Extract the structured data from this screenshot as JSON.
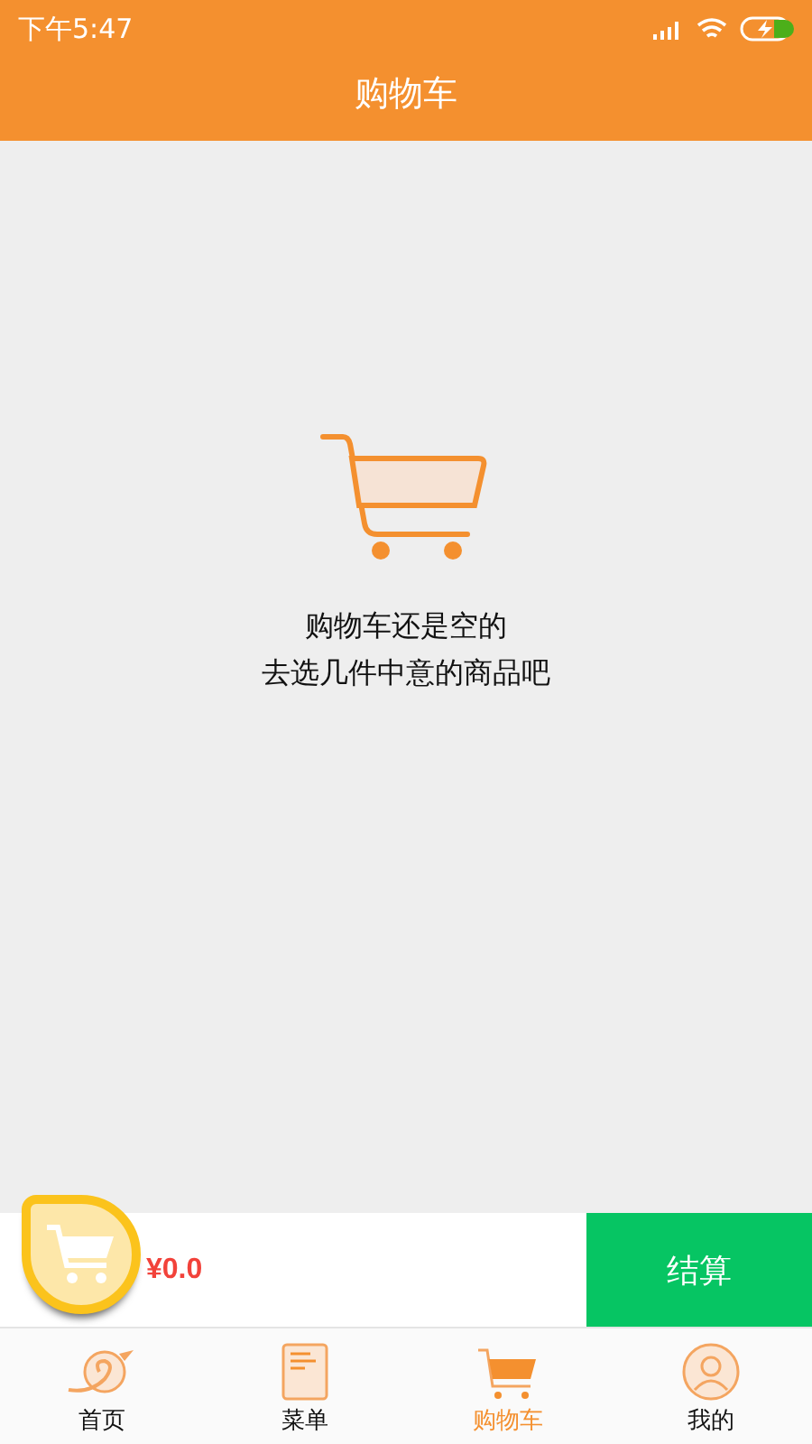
{
  "status_bar": {
    "time": "下午5:47"
  },
  "header": {
    "title": "购物车"
  },
  "empty_state": {
    "lines": [
      "购物车还是空的",
      "去选几件中意的商品吧"
    ]
  },
  "checkout_bar": {
    "total": "¥0.0",
    "button": "结算"
  },
  "tabs": [
    {
      "label": "首页",
      "kind": "home",
      "selected": false
    },
    {
      "label": "菜单",
      "kind": "menu",
      "selected": false
    },
    {
      "label": "购物车",
      "kind": "cart",
      "selected": true
    },
    {
      "label": "我的",
      "kind": "profile",
      "selected": false
    }
  ]
}
